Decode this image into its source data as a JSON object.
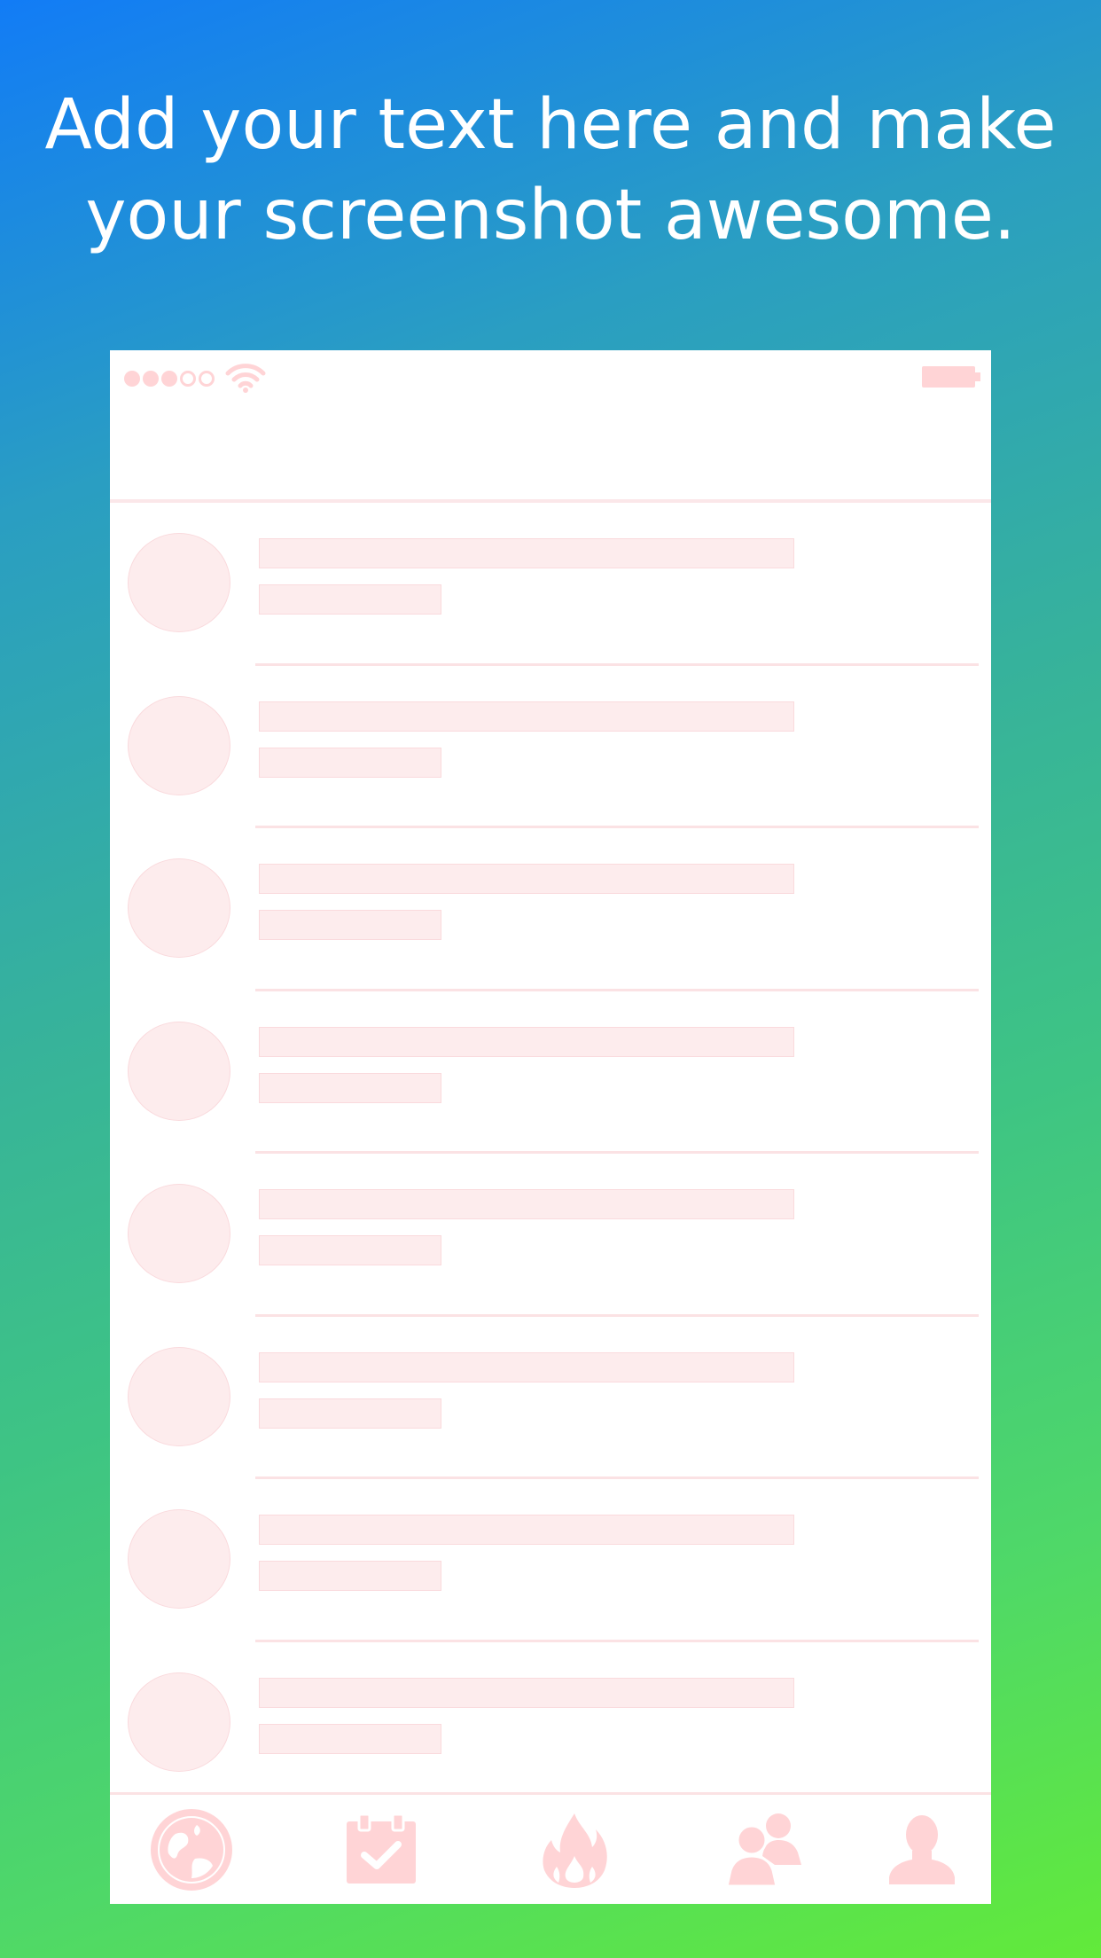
{
  "headline": {
    "line1": "Add your text here and make",
    "line2": "your screenshot awesome."
  },
  "colors": {
    "background_gradient": [
      "#127cf6",
      "#37b39a",
      "#62ea3a"
    ],
    "placeholder_fill": "#fdeced",
    "icon_pink": "#ffd4d6",
    "phone_screen": "#ffffff"
  },
  "status_bar": {
    "signal_dots_filled": 3,
    "signal_dots_total": 5,
    "icons": [
      "signal-dots-icon",
      "wifi-icon",
      "battery-icon"
    ]
  },
  "list": {
    "item_count": 8,
    "items": [
      "placeholder",
      "placeholder",
      "placeholder",
      "placeholder",
      "placeholder",
      "placeholder",
      "placeholder",
      "placeholder"
    ]
  },
  "tab_bar": {
    "tabs": [
      {
        "icon": "globe-icon"
      },
      {
        "icon": "calendar-check-icon"
      },
      {
        "icon": "fire-icon"
      },
      {
        "icon": "group-icon"
      },
      {
        "icon": "user-icon"
      }
    ]
  }
}
